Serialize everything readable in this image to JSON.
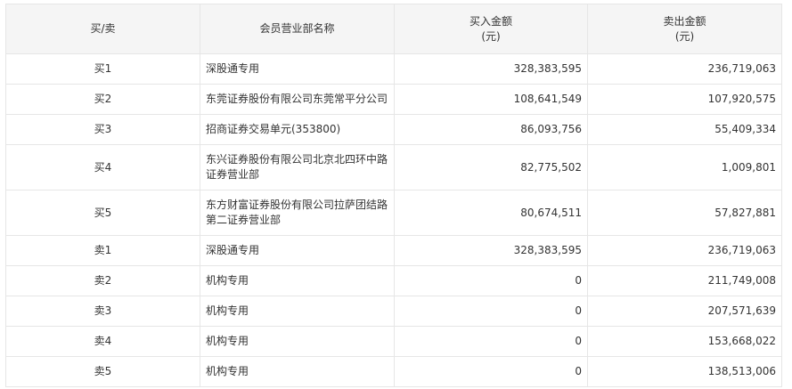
{
  "table": {
    "headers": {
      "side": "买/卖",
      "member": "会员营业部名称",
      "buy_line1": "买入金额",
      "buy_line2": "(元)",
      "sell_line1": "卖出金额",
      "sell_line2": "(元)"
    },
    "rows": [
      {
        "side": "买1",
        "name_line1": "深股通专用",
        "name_line2": "",
        "buy": "328,383,595",
        "sell": "236,719,063"
      },
      {
        "side": "买2",
        "name_line1": "东莞证券股份有限公司东莞常平分公司",
        "name_line2": "",
        "buy": "108,641,549",
        "sell": "107,920,575"
      },
      {
        "side": "买3",
        "name_line1": "招商证券交易单元(353800)",
        "name_line2": "",
        "buy": "86,093,756",
        "sell": "55,409,334"
      },
      {
        "side": "买4",
        "name_line1": "东兴证券股份有限公司北京北四环中路",
        "name_line2": "证券营业部",
        "buy": "82,775,502",
        "sell": "1,009,801"
      },
      {
        "side": "买5",
        "name_line1": "东方财富证券股份有限公司拉萨团结路",
        "name_line2": "第二证券营业部",
        "buy": "80,674,511",
        "sell": "57,827,881"
      },
      {
        "side": "卖1",
        "name_line1": "深股通专用",
        "name_line2": "",
        "buy": "328,383,595",
        "sell": "236,719,063"
      },
      {
        "side": "卖2",
        "name_line1": "机构专用",
        "name_line2": "",
        "buy": "0",
        "sell": "211,749,008"
      },
      {
        "side": "卖3",
        "name_line1": "机构专用",
        "name_line2": "",
        "buy": "0",
        "sell": "207,571,639"
      },
      {
        "side": "卖4",
        "name_line1": "机构专用",
        "name_line2": "",
        "buy": "0",
        "sell": "153,668,022"
      },
      {
        "side": "卖5",
        "name_line1": "机构专用",
        "name_line2": "",
        "buy": "0",
        "sell": "138,513,006"
      }
    ]
  }
}
